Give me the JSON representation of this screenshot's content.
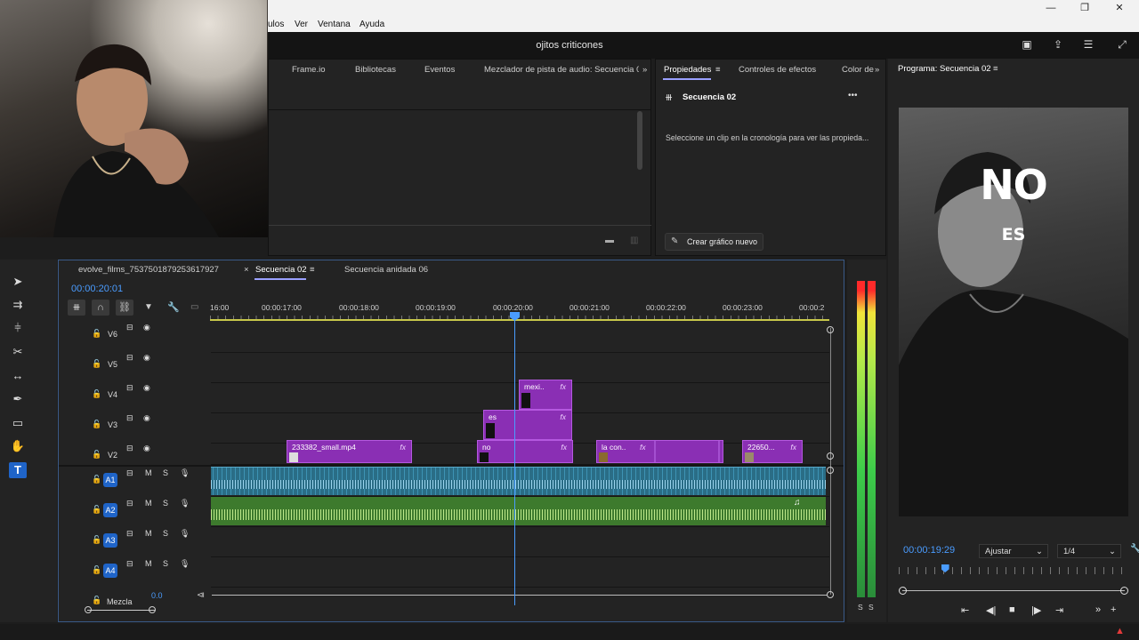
{
  "menu": {
    "items": [
      "ulos",
      "Ver",
      "Ventana",
      "Ayuda"
    ]
  },
  "window": {
    "minimize": "—",
    "maximize": "❐",
    "close": "✕"
  },
  "project": {
    "title": "ojitos criticones"
  },
  "top_panel": {
    "tabs": [
      "Frame.io",
      "Bibliotecas",
      "Eventos",
      "Mezclador de pista de audio: Secuencia 02"
    ],
    "more": "»"
  },
  "properties": {
    "tabs": [
      "Propiedades",
      "Controles de efectos",
      "Color de"
    ],
    "sequence_name": "Secuencia 02",
    "message": "Seleccione un clip en la cronología para ver las propieda...",
    "new_graphic_label": "Crear gráfico nuevo",
    "more_menu": "•••"
  },
  "program": {
    "tab": "Programa: Secuencia 02",
    "overlay_big": "NO",
    "overlay_small": "ES",
    "timecode": "00:00:19:29",
    "fit": "Ajustar",
    "resolution": "1/4",
    "playhead_progress": 0.2
  },
  "timeline": {
    "tabs": [
      "evolve_films_7537501879253617927",
      "Secuencia 02",
      "Secuencia anidada 06"
    ],
    "close_icon": "×",
    "timecode": "00:00:20:01",
    "ruler": [
      "16:00",
      "00:00:17:00",
      "00:00:18:00",
      "00:00:19:00",
      "00:00:20:00",
      "00:00:21:00",
      "00:00:22:00",
      "00:00:23:00",
      "00:00:2"
    ],
    "video_tracks": [
      "V6",
      "V5",
      "V4",
      "V3",
      "V2"
    ],
    "audio_tracks": [
      "A1",
      "A2",
      "A3",
      "A4"
    ],
    "mix_label": "Mezcla",
    "mix_value": "0.0",
    "video_clips": [
      {
        "label": "mexi..",
        "fx": "fx",
        "track": "V4"
      },
      {
        "label": "es",
        "fx": "fx",
        "track": "V3"
      },
      {
        "label": "233382_small.mp4",
        "fx": "fx",
        "track": "V2"
      },
      {
        "label": "no",
        "fx": "fx",
        "track": "V2"
      },
      {
        "label": "la con..",
        "fx": "fx",
        "track": "V2"
      },
      {
        "label": "22650...",
        "fx": "fx",
        "track": "V2"
      }
    ],
    "mute_label": "M",
    "solo_label": "S"
  },
  "meters": {
    "labels": [
      "S",
      "S"
    ]
  },
  "colors": {
    "accent_blue": "#1f64c8",
    "video_clip": "#8a2fb4",
    "audio_clip": "#2a6d86",
    "music_clip": "#3d7a2d"
  }
}
